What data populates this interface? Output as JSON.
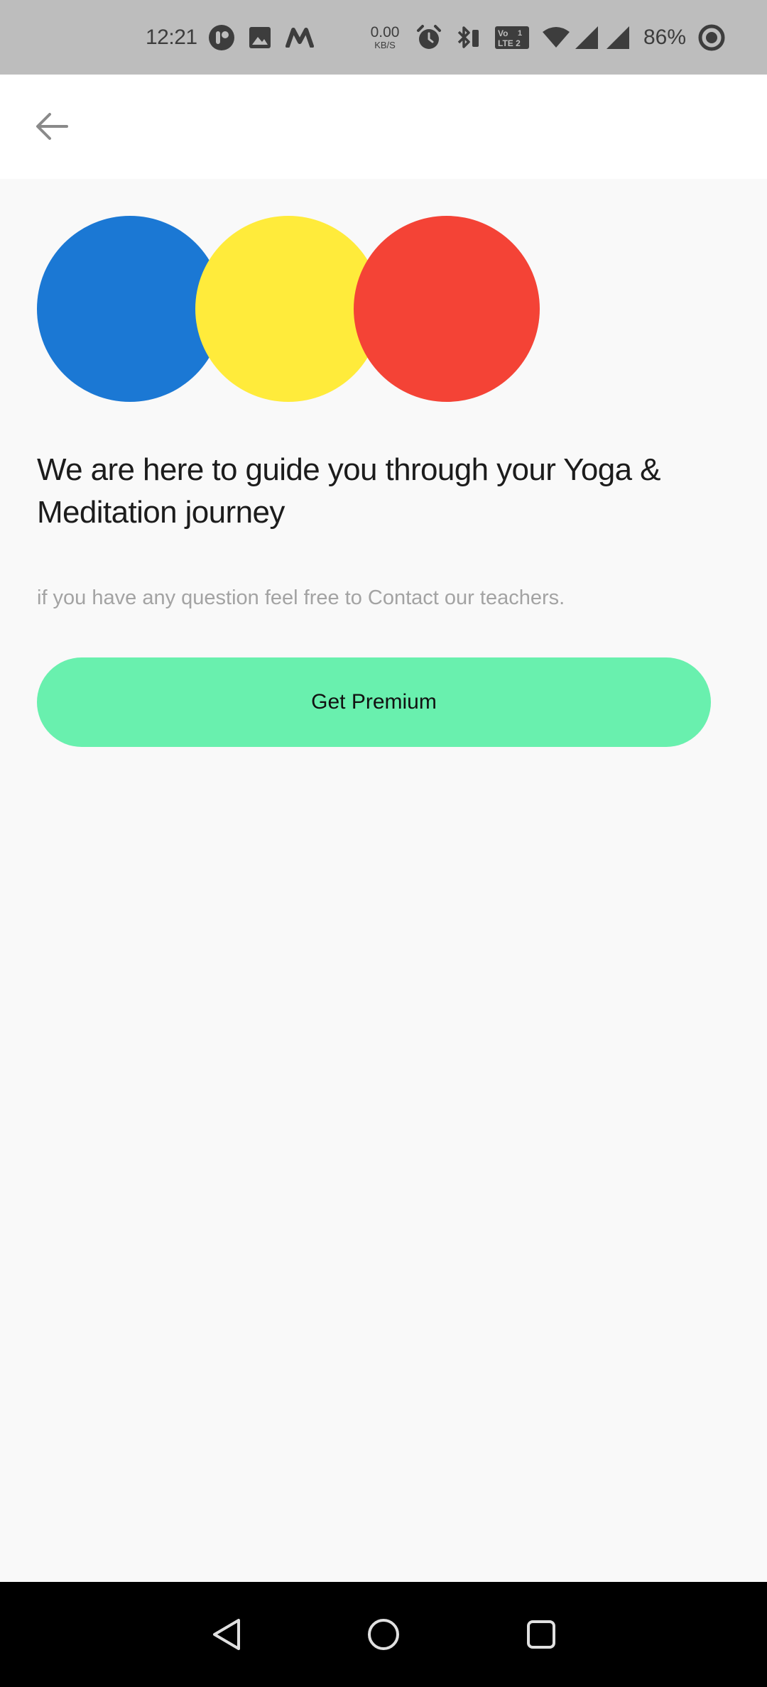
{
  "status_bar": {
    "time": "12:21",
    "network_speed_value": "0.00",
    "network_speed_unit": "KB/S",
    "battery_percent": "86%",
    "icons": [
      "notification-app-icon",
      "gallery-icon",
      "m-app-icon",
      "alarm-icon",
      "bluetooth-icon",
      "volte-lte2-icon",
      "wifi-icon",
      "signal-sim1-icon",
      "signal-sim2-icon",
      "battery-ring-icon"
    ]
  },
  "app_bar": {
    "back_icon": "arrow-left-icon"
  },
  "main": {
    "circles": [
      {
        "name": "blue-circle",
        "color": "#1b78d4"
      },
      {
        "name": "yellow-circle",
        "color": "#ffeb3b"
      },
      {
        "name": "red-circle",
        "color": "#f44336"
      }
    ],
    "headline": "We are here to guide you through your Yoga & Meditation journey",
    "subtitle": "if you have any question feel free to Contact our teachers.",
    "cta_label": "Get Premium",
    "cta_color": "#69f0ae"
  },
  "nav_bar": {
    "icons": [
      "back-triangle-icon",
      "home-circle-icon",
      "recents-square-icon"
    ]
  }
}
